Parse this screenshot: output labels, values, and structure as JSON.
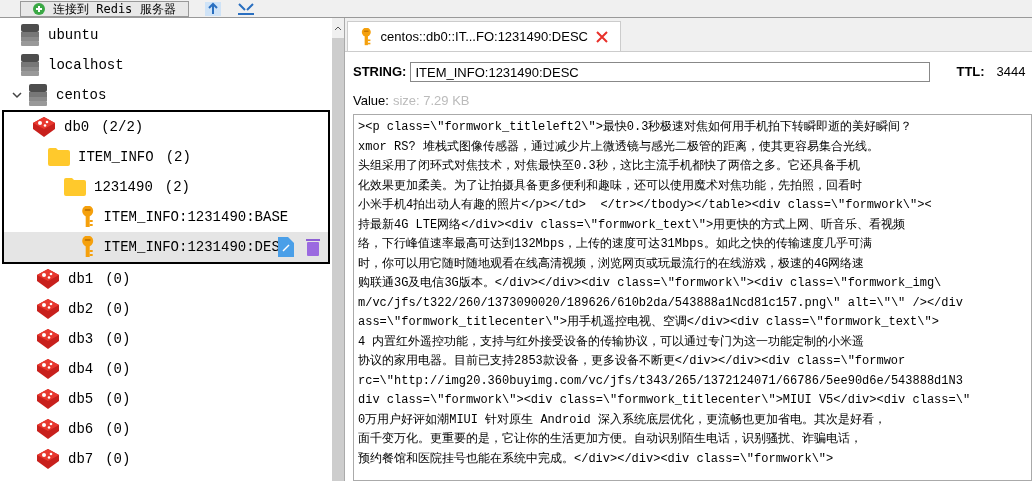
{
  "toolbar": {
    "connect_button": "连接到 Redis 服务器"
  },
  "tree": [
    {
      "kind": "server",
      "label": "ubuntu",
      "expanded": false,
      "selected": false
    },
    {
      "kind": "server",
      "label": "localhost",
      "expanded": false,
      "selected": false
    },
    {
      "kind": "server",
      "label": "centos",
      "expanded": true,
      "selected": false,
      "children": [
        {
          "kind": "db",
          "label": "db0",
          "count": "(2/2)",
          "selected": false,
          "highlighted": true,
          "children": [
            {
              "kind": "folder",
              "label": "ITEM_INFO",
              "count": "(2)",
              "selected": false,
              "children": [
                {
                  "kind": "folder",
                  "label": "1231490",
                  "count": "(2)",
                  "selected": false,
                  "children": [
                    {
                      "kind": "key",
                      "label": "ITEM_INFO:1231490:BASE",
                      "selected": false
                    },
                    {
                      "kind": "key",
                      "label": "ITEM_INFO:1231490:DES",
                      "selected": true
                    }
                  ]
                }
              ]
            }
          ]
        },
        {
          "kind": "db",
          "label": "db1",
          "count": "(0)",
          "selected": false,
          "highlighted": false
        },
        {
          "kind": "db",
          "label": "db2",
          "count": "(0)",
          "selected": false,
          "highlighted": false
        },
        {
          "kind": "db",
          "label": "db3",
          "count": "(0)",
          "selected": false,
          "highlighted": false
        },
        {
          "kind": "db",
          "label": "db4",
          "count": "(0)",
          "selected": false,
          "highlighted": false
        },
        {
          "kind": "db",
          "label": "db5",
          "count": "(0)",
          "selected": false,
          "highlighted": false
        },
        {
          "kind": "db",
          "label": "db6",
          "count": "(0)",
          "selected": false,
          "highlighted": false
        },
        {
          "kind": "db",
          "label": "db7",
          "count": "(0)",
          "selected": false,
          "highlighted": false
        }
      ]
    }
  ],
  "tabs": [
    {
      "label": "centos::db0::IT...FO:1231490:DESC",
      "selected": true
    }
  ],
  "key_header": {
    "type": "STRING:",
    "key": "ITEM_INFO:1231490:DESC",
    "ttl_label": "TTL:",
    "ttl": "3444"
  },
  "value": {
    "label": "Value:",
    "size": "size: 7.29 KB",
    "lines": [
      "><p class=\\\"formwork_titleleft2\\\">最快0.3秒极速对焦如何用手机拍下转瞬即逝的美好瞬间？",
      "xmor RS? 堆栈式图像传感器，通过减少片上微透镜与感光二极管的距离，使其更容易集合光线。",
      "头组采用了闭环式对焦技术，对焦最快至0.3秒，这比主流手机都快了两倍之多。它还具备手机",
      "化效果更加柔美。为了让拍摄具备更多便利和趣味，还可以使用魔术对焦功能，先拍照，回看时",
      "小米手机4拍出动人有趣的照片</p></td>  </tr></tbody></table><div class=\\\"formwork\\\"><",
      "持最新4G LTE网络</div><div class=\\\"formwork_text\\\">用更快的方式上网、听音乐、看视频",
      "络，下行峰值速率最高可达到132Mbps，上传的速度可达31Mbps。如此之快的传输速度几乎可满",
      "时，你可以用它随时随地观看在线高清视频，浏览网页或玩最流行的在线游戏，极速的4G网络速",
      "购联通3G及电信3G版本。</div></div><div class=\\\"formwork\\\"><div class=\\\"formwork_img\\",
      "m/vc/jfs/t322/260/1373090020/189626/610b2da/543888a1Ncd81c157.png\\\" alt=\\\"\\\" /></div",
      "ass=\\\"formwork_titlecenter\\\">用手机遥控电视、空调</div><div class=\\\"formwork_text\\\">",
      "4 内置红外遥控功能，支持与红外接受设备的传输协议，可以通过专门为这一功能定制的小米遥",
      "协议的家用电器。目前已支持2853款设备，更多设备不断更</div></div><div class=\\\"formwor",
      "rc=\\\"http://img20.360buyimg.com/vc/jfs/t343/265/1372124071/66786/5ee90d6e/543888d1N3",
      "div class=\\\"formwork\\\"><div class=\\\"formwork_titlecenter\\\">MIUI V5</div><div class=\\\"",
      "0万用户好评如潮MIUI 针对原生 Android 深入系统底层优化，更流畅也更加省电。其次是好看，",
      "面千变万化。更重要的是，它让你的生活更加方便。自动识别陌生电话，识别骚扰、诈骗电话，",
      "预约餐馆和医院挂号也能在系统中完成。</div></div><div class=\\\"formwork\\\">"
    ]
  }
}
